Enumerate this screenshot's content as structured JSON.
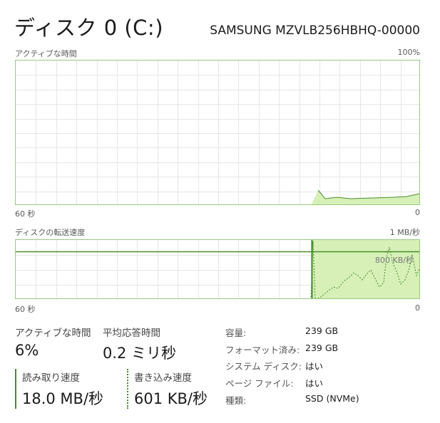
{
  "header": {
    "title": "ディスク 0 (C:)",
    "model": "SAMSUNG MZVLB256HBHQ-00000"
  },
  "active_time_graph": {
    "label": "アクティブな時間",
    "max_label": "100%",
    "x_left_label": "60 秒",
    "x_right_label": "0"
  },
  "transfer_graph": {
    "label": "ディスクの転送速度",
    "max_label": "1 MB/秒",
    "ref_line_label": "800 KB/秒",
    "x_left_label": "60 秒",
    "x_right_label": "0"
  },
  "stats": {
    "active_time_label": "アクティブな時間",
    "active_time_value": "6%",
    "avg_response_label": "平均応答時間",
    "avg_response_value": "0.2 ミリ秒",
    "read_speed_label": "読み取り速度",
    "read_speed_value": "18.0 MB/秒",
    "write_speed_label": "書き込み速度",
    "write_speed_value": "601 KB/秒"
  },
  "properties": [
    {
      "key": "容量:",
      "value": "239 GB"
    },
    {
      "key": "フォーマット済み:",
      "value": "239 GB"
    },
    {
      "key": "システム ディスク:",
      "value": "はい"
    },
    {
      "key": "ページ ファイル:",
      "value": "はい"
    },
    {
      "key": "種類:",
      "value": "SSD (NVMe)"
    }
  ],
  "colors": {
    "accent": "#4a8c2a",
    "graph_fill": "#d6f0b8",
    "graph_border": "#9ac880",
    "grid": "#e6e6e6"
  }
}
